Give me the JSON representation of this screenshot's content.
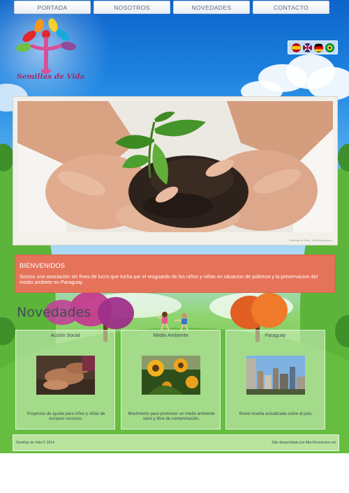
{
  "nav": {
    "items": [
      {
        "label": "PORTADA"
      },
      {
        "label": "NOSOTROS"
      },
      {
        "label": "NOVEDADES"
      },
      {
        "label": "CONTACTO"
      }
    ]
  },
  "logo": {
    "name": "Semillas de Vida",
    "colors": {
      "red": "#e3262b",
      "orange": "#f7941d",
      "yellow": "#f6d02b",
      "green": "#71bf44",
      "blue": "#1aa9dc",
      "purple": "#8e4b9e",
      "pink": "#d84e97"
    }
  },
  "languages": {
    "flags": [
      {
        "icon": "spain-flag-icon"
      },
      {
        "icon": "uk-flag-icon"
      },
      {
        "icon": "germany-flag-icon"
      },
      {
        "icon": "brazil-flag-icon"
      }
    ]
  },
  "hero": {
    "caption": "Semillas de Vida - Alta-Resolucion"
  },
  "welcome": {
    "title": "BIENVENIDOS",
    "text": "Somos una asociación sin fines de lucro que lucha por el resguardo de los niños y niñas en situacion de pobreza y la preservacion del medio ambiete en Paraguay.",
    "color": "#e5735a"
  },
  "novedades": {
    "heading": "Novedades",
    "cards": [
      {
        "title": "Acción Social",
        "description": "Proyectos de ayuda para niños y niñas de escasos recursos."
      },
      {
        "title": "Medio Ambiente",
        "description": "Movimiento para promover un medio ambiente sano y libre de contaminación."
      },
      {
        "title": "Paraguay",
        "description": "Breve reseña actualizada sobre el país."
      }
    ]
  },
  "footer": {
    "copyright": "Semillas de Vida © 2014",
    "credit": "Sitio desarrollado por Alta-Resolucion.net"
  }
}
